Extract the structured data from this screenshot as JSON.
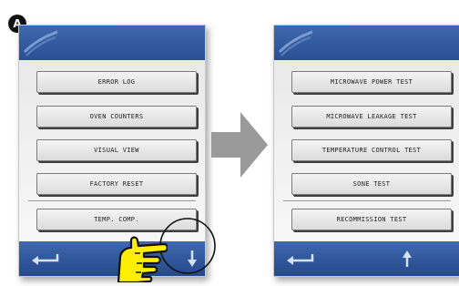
{
  "badge": {
    "label": "A"
  },
  "left_screen": {
    "menu": [
      {
        "label": "ERROR LOG"
      },
      {
        "label": "OVEN COUNTERS"
      },
      {
        "label": "VISUAL VIEW"
      },
      {
        "label": "FACTORY RESET"
      },
      {
        "label": "TEMP. COMP."
      }
    ],
    "bottom_bar": {
      "back_icon": "return-arrow-icon",
      "nav_icon": "arrow-down-icon"
    }
  },
  "right_screen": {
    "menu": [
      {
        "label": "MICROWAVE POWER TEST"
      },
      {
        "label": "MICROWAVE LEAKAGE TEST"
      },
      {
        "label": "TEMPERATURE CONTROL TEST"
      },
      {
        "label": "SONE TEST"
      },
      {
        "label": "RECOMMISSION TEST"
      }
    ],
    "bottom_bar": {
      "back_icon": "return-arrow-icon",
      "nav_icon": "arrow-up-icon"
    }
  },
  "colors": {
    "bar_blue": "#2f5a9f",
    "hand_yellow": "#ffee00",
    "transition_arrow": "#9a9a9a"
  }
}
